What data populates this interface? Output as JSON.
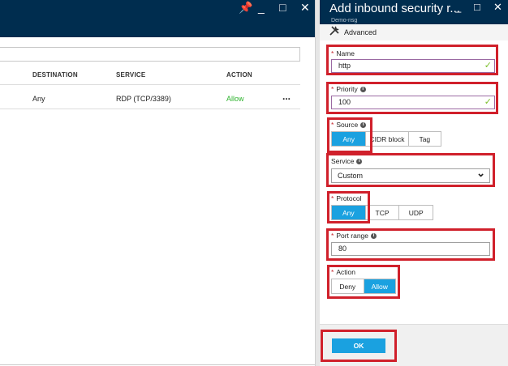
{
  "left": {
    "header": {
      "pin": "📌",
      "minimize": "_",
      "maximize": "□",
      "close": "✕"
    },
    "columns": [
      "DESTINATION",
      "SERVICE",
      "ACTION"
    ],
    "rows": [
      {
        "destination": "Any",
        "service": "RDP (TCP/3389)",
        "action": "Allow",
        "more": "..."
      }
    ]
  },
  "blade": {
    "title": "Add inbound security r...",
    "subtitle": "Demo-nsg",
    "advanced_label": "Advanced",
    "header_icons": {
      "minimize": "_",
      "maximize": "□",
      "close": "✕"
    }
  },
  "form": {
    "name": {
      "required": "*",
      "label": "Name",
      "value": "http",
      "check": "✓"
    },
    "priority": {
      "required": "*",
      "label": "Priority",
      "info": "i",
      "value": "100",
      "check": "✓"
    },
    "source": {
      "required": "*",
      "label": "Source",
      "info": "i",
      "options": [
        "Any",
        "CIDR block",
        "Tag"
      ],
      "selected": "Any"
    },
    "service": {
      "label": "Service",
      "info": "i",
      "value": "Custom",
      "chevron": "⌄"
    },
    "protocol": {
      "required": "*",
      "label": "Protocol",
      "options": [
        "Any",
        "TCP",
        "UDP"
      ],
      "selected": "Any"
    },
    "port_range": {
      "required": "*",
      "label": "Port range",
      "info": "i",
      "value": "80"
    },
    "action": {
      "required": "*",
      "label": "Action",
      "options": [
        "Deny",
        "Allow"
      ],
      "selected": "Allow"
    }
  },
  "footer": {
    "ok_label": "OK"
  },
  "colors": {
    "header": "#002d4f",
    "accent": "#1aa1e0",
    "annotation": "#d0202b",
    "allow": "#2db32d"
  }
}
